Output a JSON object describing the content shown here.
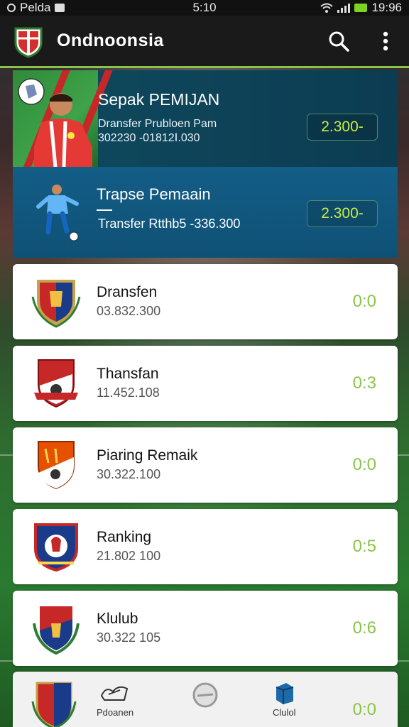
{
  "status_bar": {
    "carrier": "Pelda",
    "time": "5:10",
    "battery_time": "19:96"
  },
  "app_bar": {
    "title": "Ondnoonsia"
  },
  "featured": [
    {
      "title": "Sepak PEMIJAN",
      "subtitle_line1": "Dransfer Prubloen Pam",
      "subtitle_line2": "302230 -01812Ⅰ.030",
      "value": "2.300-"
    },
    {
      "title": "Trapse Pemaain",
      "subtitle_line1": "Transfer Rtthb5 -336.300",
      "value": "2.300-"
    }
  ],
  "list_items": [
    {
      "name": "Dransfen",
      "number": "03.832.300",
      "score": "0:0"
    },
    {
      "name": "Thansfan",
      "number": "11.452.108",
      "score": "0:3"
    },
    {
      "name": "Piaring Remaik",
      "number": "30.322.100",
      "score": "0:0"
    },
    {
      "name": "Ranking",
      "number": "21.802 100",
      "score": "0:5"
    },
    {
      "name": "Klulub",
      "number": "30.322 105",
      "score": "0:6"
    }
  ],
  "bottom_nav": {
    "item1_label": "Pdoanen",
    "item3_label": "Clulol",
    "score": "0:0"
  },
  "colors": {
    "accent": "#8bc34a",
    "hero_bg": "#0c3c52",
    "hero2_bg": "#135d86"
  }
}
